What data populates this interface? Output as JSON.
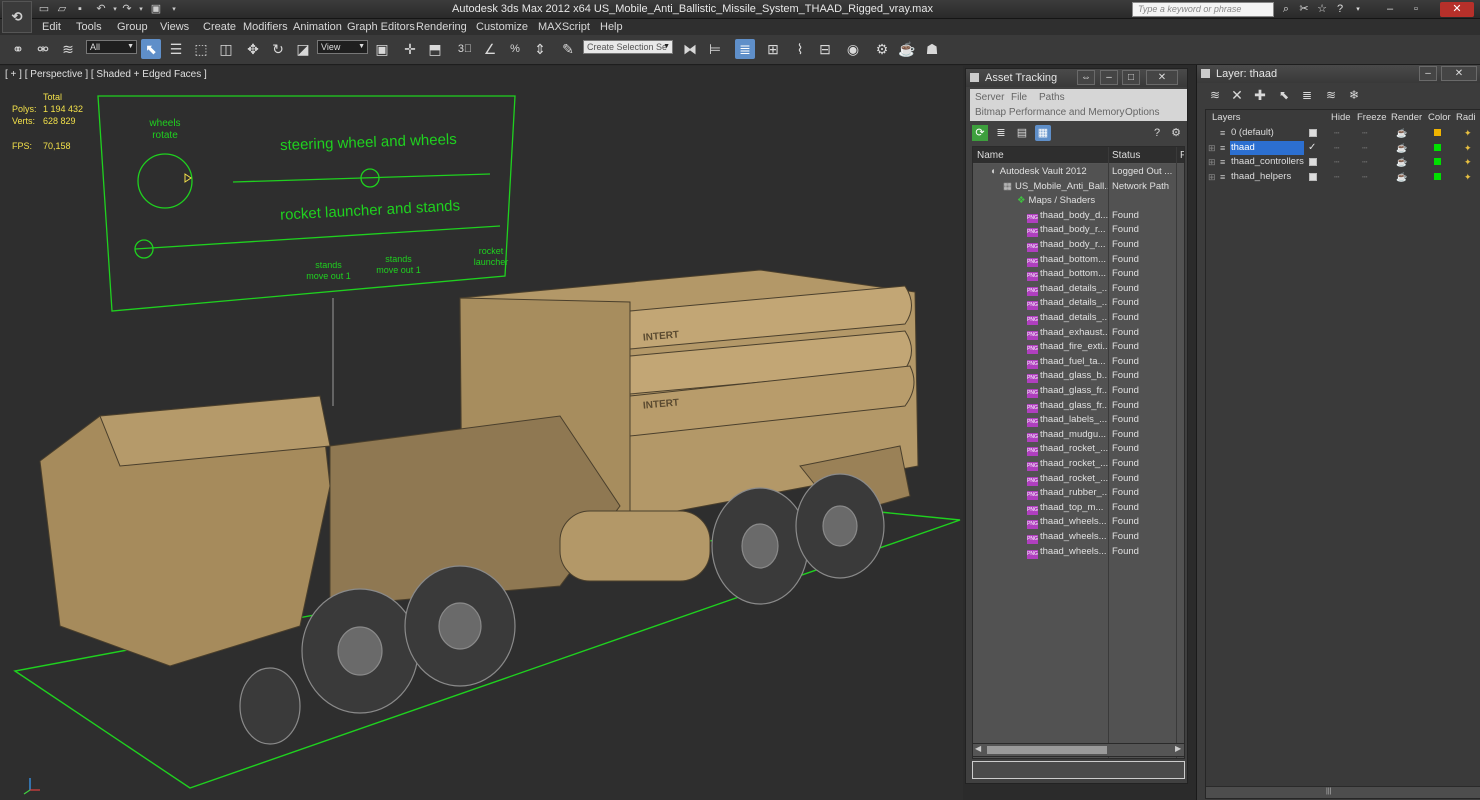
{
  "titlebar": {
    "app_icon": "3ds-max-logo",
    "title": "Autodesk 3ds Max  2012 x64     US_Mobile_Anti_Ballistic_Missile_System_THAAD_Rigged_vray.max",
    "search_placeholder": "Type a keyword or phrase"
  },
  "menu": [
    "Edit",
    "Tools",
    "Group",
    "Views",
    "Create",
    "Modifiers",
    "Animation",
    "Graph Editors",
    "Rendering",
    "Customize",
    "MAXScript",
    "Help"
  ],
  "toolbar": {
    "filter_value": "All",
    "refcoord_value": "View",
    "selection_set_placeholder": "Create Selection Se"
  },
  "viewport": {
    "label": "[ + ] [ Perspective ] [ Shaded + Edged Faces ]",
    "stats": {
      "total_label": "Total",
      "polys_label": "Polys:",
      "polys": "1 194 432",
      "verts_label": "Verts:",
      "verts": "628 829",
      "fps_label": "FPS:",
      "fps": "70,158"
    },
    "rig_panel": {
      "wheels_rotate": "wheels rotate",
      "steering": "steering wheel and wheels",
      "rocket": "rocket launcher and stands",
      "stands1": "stands move out 1",
      "stands2": "stands move out 1",
      "launcher": "rocket launcher"
    },
    "truck_labels": [
      "INTERT",
      "INTERT"
    ]
  },
  "asset_tracking": {
    "title": "Asset Tracking",
    "menus": [
      "Server",
      "File",
      "Paths",
      "Bitmap Performance and Memory",
      "Options"
    ],
    "columns": {
      "name": "Name",
      "status": "Status",
      "path": "P"
    },
    "rows": [
      {
        "name": "Autodesk Vault 2012",
        "status": "Logged Out ...",
        "indent": 0,
        "icon": "vault-icon"
      },
      {
        "name": "US_Mobile_Anti_Ball...",
        "status": "Network Path",
        "indent": 1,
        "icon": "max-file-icon"
      },
      {
        "name": "Maps / Shaders",
        "status": "",
        "indent": 2,
        "icon": "maps-icon"
      },
      {
        "name": "thaad_body_d...",
        "status": "Found",
        "indent": 3,
        "icon": "png-icon"
      },
      {
        "name": "thaad_body_r...",
        "status": "Found",
        "indent": 3,
        "icon": "png-icon"
      },
      {
        "name": "thaad_body_r...",
        "status": "Found",
        "indent": 3,
        "icon": "png-icon"
      },
      {
        "name": "thaad_bottom...",
        "status": "Found",
        "indent": 3,
        "icon": "png-icon"
      },
      {
        "name": "thaad_bottom...",
        "status": "Found",
        "indent": 3,
        "icon": "png-icon"
      },
      {
        "name": "thaad_details_...",
        "status": "Found",
        "indent": 3,
        "icon": "png-icon"
      },
      {
        "name": "thaad_details_...",
        "status": "Found",
        "indent": 3,
        "icon": "png-icon"
      },
      {
        "name": "thaad_details_...",
        "status": "Found",
        "indent": 3,
        "icon": "png-icon"
      },
      {
        "name": "thaad_exhaust...",
        "status": "Found",
        "indent": 3,
        "icon": "png-icon"
      },
      {
        "name": "thaad_fire_exti...",
        "status": "Found",
        "indent": 3,
        "icon": "png-icon"
      },
      {
        "name": "thaad_fuel_ta...",
        "status": "Found",
        "indent": 3,
        "icon": "png-icon"
      },
      {
        "name": "thaad_glass_b...",
        "status": "Found",
        "indent": 3,
        "icon": "png-icon"
      },
      {
        "name": "thaad_glass_fr...",
        "status": "Found",
        "indent": 3,
        "icon": "png-icon"
      },
      {
        "name": "thaad_glass_fr...",
        "status": "Found",
        "indent": 3,
        "icon": "png-icon"
      },
      {
        "name": "thaad_labels_...",
        "status": "Found",
        "indent": 3,
        "icon": "png-icon"
      },
      {
        "name": "thaad_mudgu...",
        "status": "Found",
        "indent": 3,
        "icon": "png-icon"
      },
      {
        "name": "thaad_rocket_...",
        "status": "Found",
        "indent": 3,
        "icon": "png-icon"
      },
      {
        "name": "thaad_rocket_...",
        "status": "Found",
        "indent": 3,
        "icon": "png-icon"
      },
      {
        "name": "thaad_rocket_...",
        "status": "Found",
        "indent": 3,
        "icon": "png-icon"
      },
      {
        "name": "thaad_rubber_...",
        "status": "Found",
        "indent": 3,
        "icon": "png-icon"
      },
      {
        "name": "thaad_top_m...",
        "status": "Found",
        "indent": 3,
        "icon": "png-icon"
      },
      {
        "name": "thaad_wheels...",
        "status": "Found",
        "indent": 3,
        "icon": "png-icon"
      },
      {
        "name": "thaad_wheels...",
        "status": "Found",
        "indent": 3,
        "icon": "png-icon"
      },
      {
        "name": "thaad_wheels...",
        "status": "Found",
        "indent": 3,
        "icon": "png-icon"
      }
    ]
  },
  "layer_panel": {
    "title": "Layer: thaad",
    "columns": [
      "Layers",
      "Hide",
      "Freeze",
      "Render",
      "Color",
      "Radi"
    ],
    "rows": [
      {
        "name": "0 (default)",
        "selected": false,
        "current": false,
        "color": "#f0b400"
      },
      {
        "name": "thaad",
        "selected": true,
        "current": true,
        "color": "#00e000"
      },
      {
        "name": "thaad_controllers",
        "selected": false,
        "current": false,
        "color": "#00e000"
      },
      {
        "name": "thaad_helpers",
        "selected": false,
        "current": false,
        "color": "#00e000"
      }
    ]
  },
  "colors": {
    "wireframe_green": "#1fd11f",
    "truck_tan": "#b59a6a",
    "stats_yellow": "#f2e04a",
    "selection_blue": "#2c6fd0"
  }
}
